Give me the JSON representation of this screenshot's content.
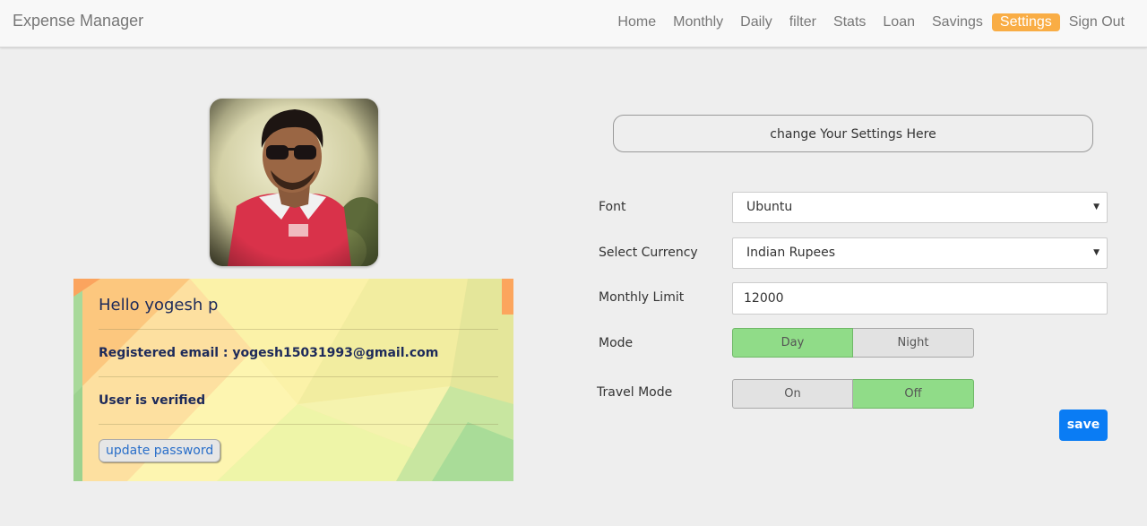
{
  "app": {
    "brand": "Expense Manager"
  },
  "nav": {
    "items": [
      {
        "label": "Home"
      },
      {
        "label": "Monthly"
      },
      {
        "label": "Daily"
      },
      {
        "label": "filter"
      },
      {
        "label": "Stats"
      },
      {
        "label": "Loan"
      },
      {
        "label": "Savings"
      },
      {
        "label": "Settings",
        "active": true
      },
      {
        "label": "Sign Out"
      }
    ],
    "active_color": "#f9ad45"
  },
  "profile": {
    "greeting": "Hello yogesh p",
    "email_line": "Registered email : yogesh15031993@gmail.com",
    "verified_line": "User is verified",
    "update_password_label": "update password"
  },
  "settings": {
    "header": "change Your Settings Here",
    "font": {
      "label": "Font",
      "value": "Ubuntu"
    },
    "currency": {
      "label": "Select Currency",
      "value": "Indian Rupees"
    },
    "monthly_limit": {
      "label": "Monthly Limit",
      "value": "12000"
    },
    "mode": {
      "label": "Mode",
      "options": [
        "Day",
        "Night"
      ],
      "selected": "Day"
    },
    "travel_mode": {
      "label": "Travel Mode",
      "options": [
        "On",
        "Off"
      ],
      "selected": "Off"
    },
    "save_label": "save",
    "save_color": "#0a7cf4",
    "toggle_selected_color": "#90dc88"
  }
}
